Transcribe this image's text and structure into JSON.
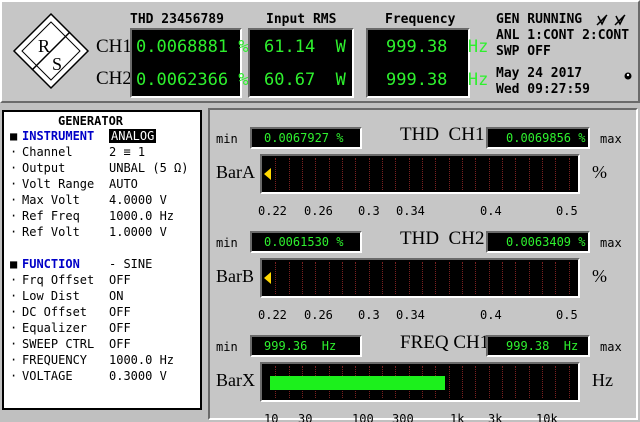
{
  "header": {
    "thd_heading": "THD 23456789",
    "rms_heading": "Input RMS",
    "freq_heading": "Frequency",
    "ch1_label": "CH1",
    "ch2_label": "CH2",
    "ch1": {
      "thd": "0.0068881 %",
      "rms": "61.14  W",
      "freq": "999.38  Hz"
    },
    "ch2": {
      "thd": "0.0062366 %",
      "rms": "60.67  W",
      "freq": "999.38  Hz"
    },
    "status_line1": "GEN RUNNING",
    "status_line2": "ANL 1:CONT 2:CONT",
    "status_line3": "SWP OFF",
    "date": "May 24 2017",
    "time": "Wed 09:27:59",
    "logo_text": "R/S"
  },
  "generator": {
    "title": "GENERATOR",
    "rows": [
      {
        "bullet": "■",
        "label": "INSTRUMENT",
        "value": "ANALOG",
        "blue": true,
        "selected": true
      },
      {
        "bullet": "·",
        "label": "Channel",
        "value": "2 ≡ 1"
      },
      {
        "bullet": "·",
        "label": "Output",
        "value": "UNBAL (5 Ω)"
      },
      {
        "bullet": "·",
        "label": "Volt Range",
        "value": "AUTO"
      },
      {
        "bullet": "·",
        "label": "Max Volt",
        "value": "4.0000 V"
      },
      {
        "bullet": "·",
        "label": "Ref Freq",
        "value": "1000.0 Hz"
      },
      {
        "bullet": "·",
        "label": "Ref Volt",
        "value": "1.0000 V"
      },
      {
        "bullet": "",
        "label": "",
        "value": ""
      },
      {
        "bullet": "■",
        "label": "FUNCTION",
        "value": "- SINE",
        "blue": true
      },
      {
        "bullet": "·",
        "label": "Frq Offset",
        "value": "OFF"
      },
      {
        "bullet": "·",
        "label": "Low Dist",
        "value": "ON"
      },
      {
        "bullet": "·",
        "label": "DC Offset",
        "value": "OFF"
      },
      {
        "bullet": "·",
        "label": "Equalizer",
        "value": "OFF"
      },
      {
        "bullet": "·",
        "label": "SWEEP CTRL",
        "value": "OFF"
      },
      {
        "bullet": "·",
        "label": "FREQUENCY",
        "value": "1000.0 Hz"
      },
      {
        "bullet": "·",
        "label": "VOLTAGE",
        "value": "0.3000 V"
      }
    ]
  },
  "bars": [
    {
      "title": "THD  CH1",
      "name": "BarA",
      "unit": "%",
      "min_label": "min",
      "max_label": "max",
      "min": "0.0067927 %",
      "max": "0.0069856 %",
      "ticks": [
        "0.22",
        "0.26",
        "0.3",
        "0.34",
        "0.4",
        "0.5"
      ],
      "fill_fraction": 0
    },
    {
      "title": "THD  CH2",
      "name": "BarB",
      "unit": "%",
      "min_label": "min",
      "max_label": "max",
      "min": "0.0061530 %",
      "max": "0.0063409 %",
      "ticks": [
        "0.22",
        "0.26",
        "0.3",
        "0.34",
        "0.4",
        "0.5"
      ],
      "fill_fraction": 0
    },
    {
      "title": "FREQ CH1",
      "name": "BarX",
      "unit": "Hz",
      "min_label": "min",
      "max_label": "max",
      "min": "999.36  Hz",
      "max": "999.38  Hz",
      "ticks": [
        "10",
        "30",
        "100",
        "300",
        "1k",
        "3k",
        "10k"
      ],
      "fill_fraction": 0.575
    }
  ],
  "colors": {
    "lcd_text": "#2ef02e",
    "bar_fill": "#1cf01c",
    "marker": "#ffd800",
    "func_blue": "#0000c8"
  }
}
